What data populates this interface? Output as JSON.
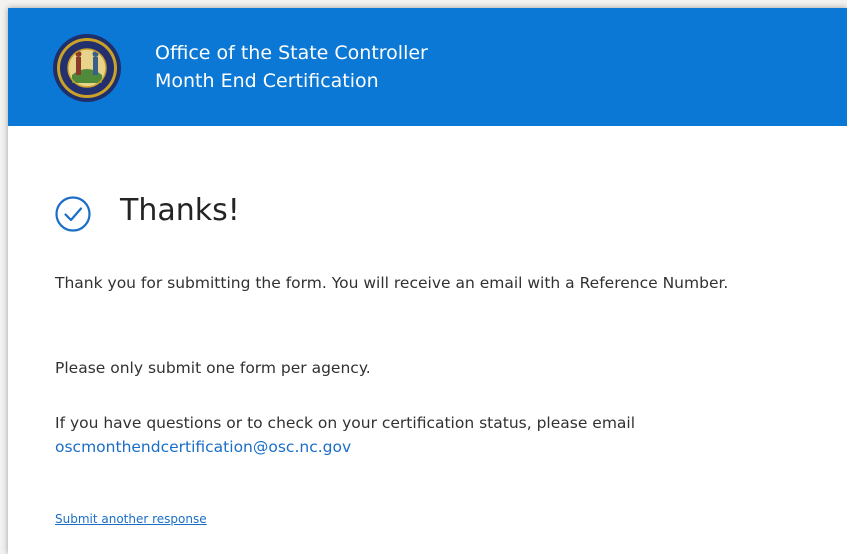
{
  "header": {
    "org_name": "Office of the State Controller",
    "form_name": "Month End Certification",
    "logo_icon": "nc-state-seal-icon",
    "banner_color": "#0a78d4"
  },
  "confirmation": {
    "icon": "check-circle-icon",
    "heading": "Thanks!",
    "message_1": "Thank you for submitting the form. You will receive an email with a Reference Number.",
    "message_2": "Please only submit one form per agency.",
    "message_3": "If you have questions or to check on your certification status, please email",
    "contact_email": "oscmonthendcertification@osc.nc.gov",
    "submit_another_label": "Submit another response",
    "accent_color": "#1a6ec7"
  }
}
